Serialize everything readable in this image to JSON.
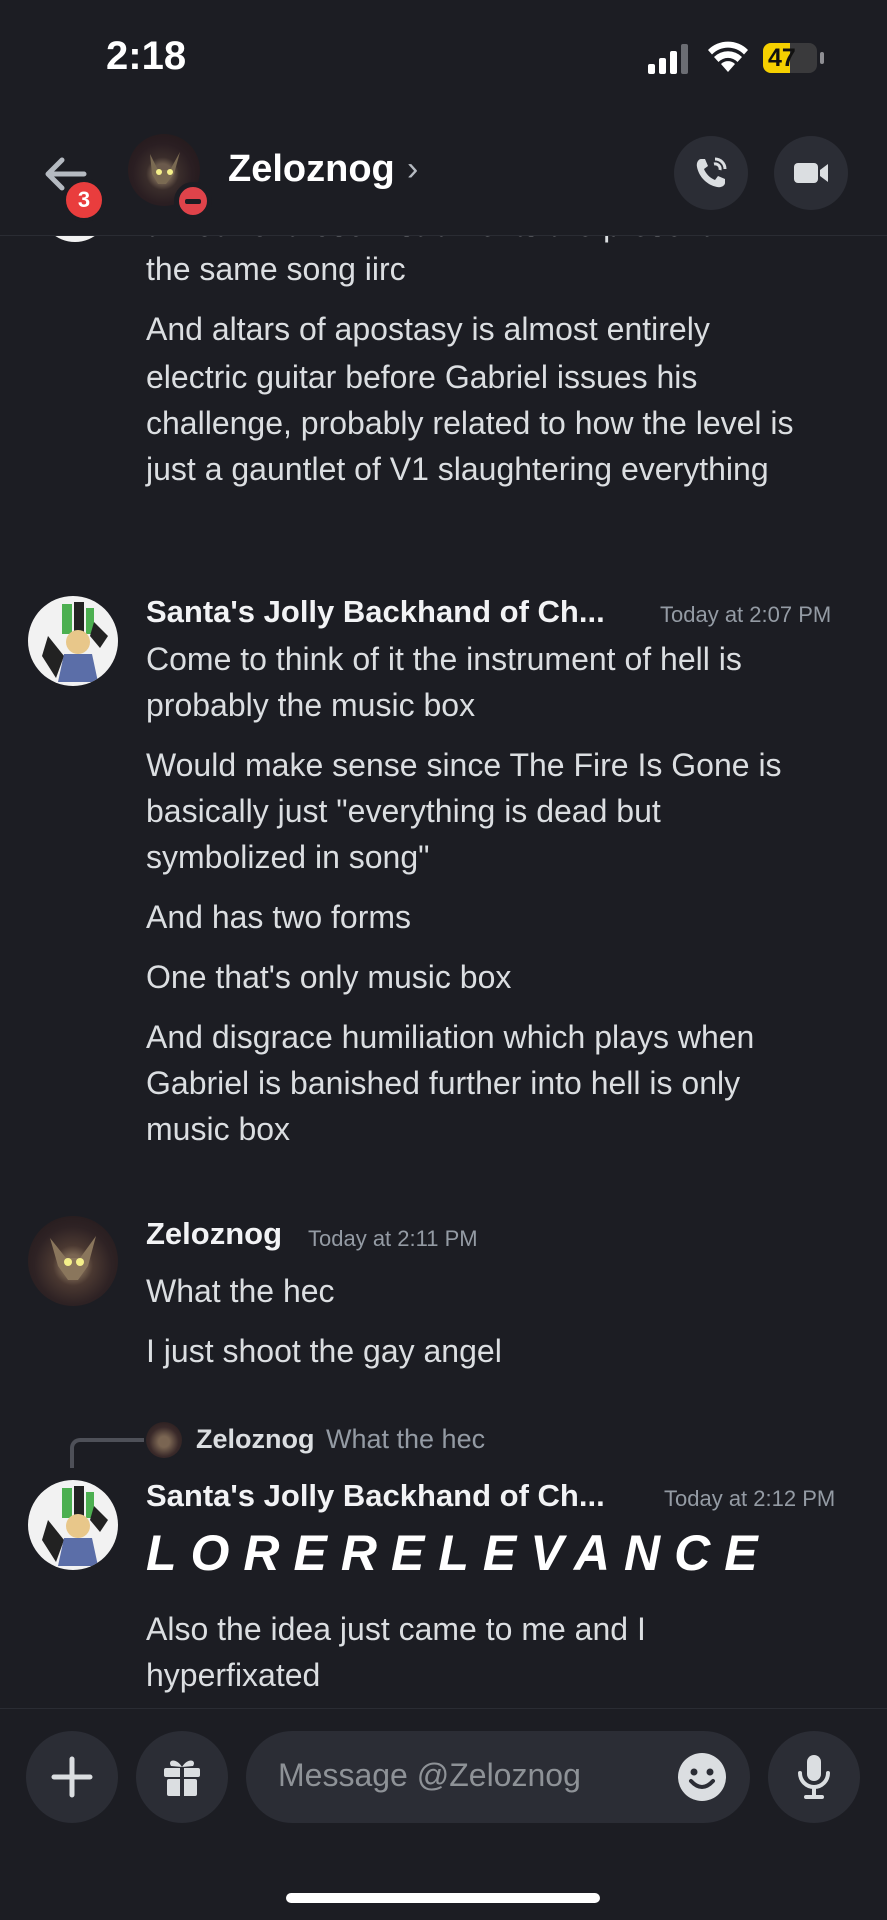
{
  "status_bar": {
    "time": "2:18",
    "battery": "47"
  },
  "header": {
    "name": "Zeloznog",
    "chevron": "›",
    "unread_badge": "3"
  },
  "messages": {
    "continuation_lines": [
      "all four of those instruments are present in",
      "the same song iirc",
      "And altars of apostasy is almost entirely",
      "electric guitar before Gabriel issues his",
      "challenge, probably related to how the level is",
      "just a gauntlet of V1 slaughtering everything"
    ],
    "group1": {
      "author": "Santa's Jolly Backhand of Ch...",
      "timestamp": "Today at 2:07 PM",
      "lines": [
        "Come to think of it the instrument of hell is",
        "probably the music box",
        "Would make sense since The Fire Is Gone is",
        "basically just \"everything is dead but",
        "symbolized in song\"",
        "And has two forms",
        "One that's only music box",
        "And disgrace humiliation which plays when",
        "Gabriel is banished further into hell is only",
        "music box"
      ]
    },
    "group2": {
      "author": "Zeloznog",
      "timestamp": "Today at 2:11 PM",
      "lines": [
        "What the hec",
        "I just shoot the gay angel"
      ]
    },
    "group3": {
      "reply_author": "Zeloznog",
      "reply_text": "What the hec",
      "author": "Santa's Jolly Backhand of Ch...",
      "timestamp": "Today at 2:12 PM",
      "big_text": "LORERELEVANCE",
      "lines": [
        "Also the idea just came to me and I",
        "hyperfixated"
      ]
    }
  },
  "composer": {
    "placeholder": "Message @Zeloznog"
  },
  "colors": {
    "background": "#1c1d23",
    "badge": "#e93d3d",
    "battery": "#f5d000"
  }
}
